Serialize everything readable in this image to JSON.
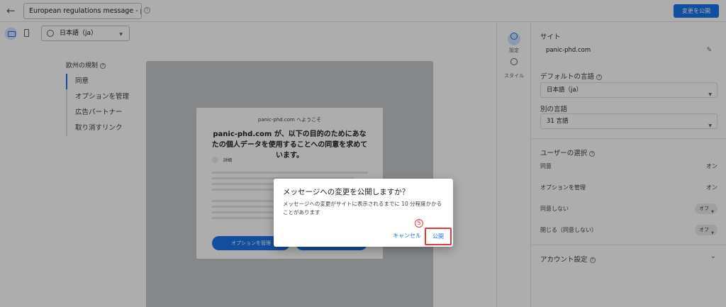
{
  "topbar": {
    "title": "European regulations message - panic-p",
    "publish_label": "変更を公開"
  },
  "toolbar": {
    "language": "日本語（ja）"
  },
  "left_nav": {
    "title": "欧州の規制",
    "items": [
      {
        "label": "同意"
      },
      {
        "label": "オプションを管理"
      },
      {
        "label": "広告パートナー"
      },
      {
        "label": "取り消すリンク"
      }
    ]
  },
  "preview": {
    "welcome": "panic-phd.com へようこそ",
    "heading": "panic-phd.com が、以下の目的のためにあなたの個人データを使用することへの同意を求めています。",
    "detail_label": "詳細",
    "manage_button": "オプションを管理"
  },
  "side_rail": {
    "settings_label": "設定",
    "style_label": "スタイル"
  },
  "panel": {
    "site_label": "サイト",
    "site_value": "panic-phd.com",
    "default_lang_label": "デフォルトの言語",
    "default_lang_value": "日本語（ja）",
    "other_lang_label": "別の言語",
    "other_lang_value": "31 言語",
    "user_choice_label": "ユーザーの選択",
    "rows": [
      {
        "label": "同意",
        "value": "オン"
      },
      {
        "label": "オプションを管理",
        "value": "オン"
      },
      {
        "label": "同意しない",
        "value": "オフ"
      },
      {
        "label": "閉じる（同意しない）",
        "value": "オフ"
      }
    ],
    "account_label": "アカウント設定"
  },
  "dialog": {
    "title": "メッセージへの変更を公開しますか？",
    "body": "メッセージへの変更がサイトに表示されるまでに 10 分程度かかることがあります",
    "cancel_label": "キャンセル",
    "publish_label": "公開",
    "step_number": "5"
  },
  "colors": {
    "accent": "#1a73e8",
    "highlight": "#e53935",
    "overlay": "rgba(0,0,0,0.32)"
  }
}
